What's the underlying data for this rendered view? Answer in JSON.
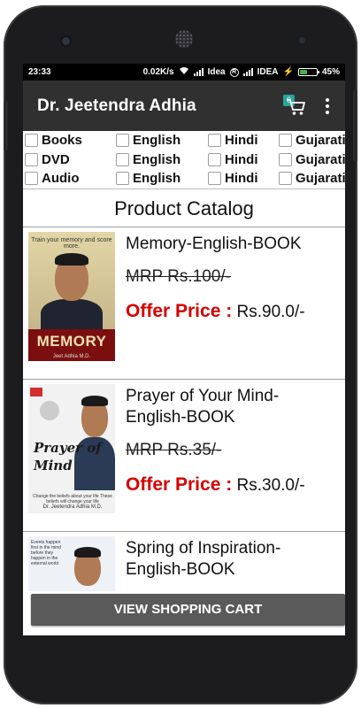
{
  "status_bar": {
    "time": "23:33",
    "net_speed": "0.02K/s",
    "carrier1": "Idea",
    "carrier2": "IDEA",
    "battery": "45%",
    "battery_level": 0.45
  },
  "app_bar": {
    "title": "Dr. Jeetendra Adhia",
    "cart_count": "0",
    "cart_icon": "shopping-cart-icon",
    "overflow_icon": "more-vert-icon",
    "accent_color": "#26a69a"
  },
  "filters": {
    "rows": [
      {
        "type": "Books",
        "lang1": "English",
        "lang2": "Hindi",
        "lang3": "Gujarati"
      },
      {
        "type": "DVD",
        "lang1": "English",
        "lang2": "Hindi",
        "lang3": "Gujarati"
      },
      {
        "type": "Audio",
        "lang1": "English",
        "lang2": "Hindi",
        "lang3": "Gujarati"
      }
    ]
  },
  "catalog": {
    "title": "Product Catalog",
    "offer_label": "Offer Price :",
    "products": [
      {
        "name": "Memory-English-BOOK",
        "mrp": "MRP Rs.100/-",
        "offer_price": "Rs.90.0/-",
        "cover_title": "MEMORY",
        "cover_tagline": "Train your memory and score more.",
        "cover_author": "Jeet Adhia M.D."
      },
      {
        "name": "Prayer of Your Mind-English-BOOK",
        "mrp": "MRP Rs.35/-",
        "offer_price": "Rs.30.0/-",
        "cover_title_line1": "Prayer of",
        "cover_title_line2": "Mind",
        "cover_small": "Change the beliefs about your life These beliefs will change your life",
        "cover_author": "Dr. Jeetendra Adhia M.D."
      },
      {
        "name": "Spring of Inspiration-English-BOOK",
        "cover_small": "Events happen first in the mind before they happen in the external world"
      }
    ]
  },
  "view_cart_label": "VIEW SHOPPING CART",
  "colors": {
    "offer_red": "#d50000",
    "app_bar": "#303030",
    "cart_button": "#5a5a5a"
  }
}
